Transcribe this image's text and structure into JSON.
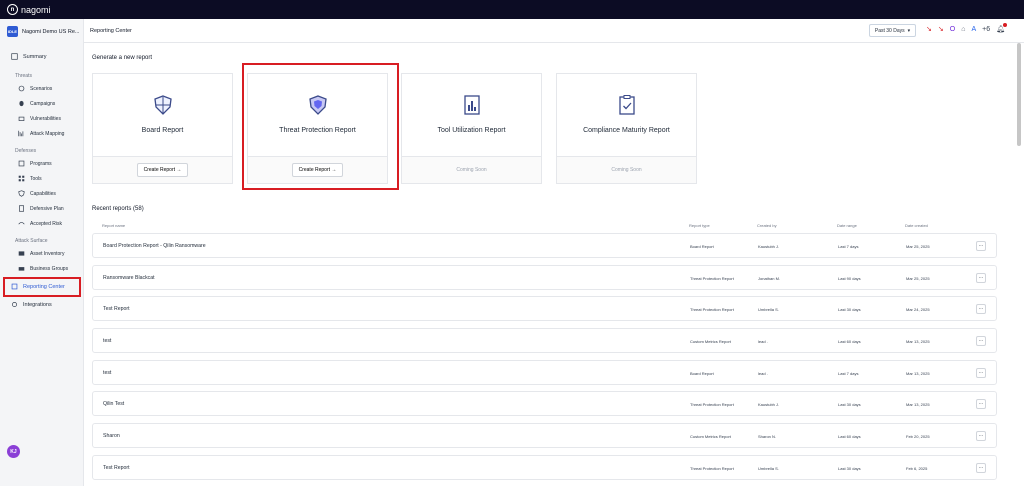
{
  "app": {
    "logo_text": "nagomi",
    "logo_mark": "n"
  },
  "org": {
    "badge": "IDLE",
    "name": "Nagomi Demo US Re..."
  },
  "header": {
    "title": "Reporting Center",
    "range": "Past 30 Days"
  },
  "sidebar": {
    "summary": "Summary",
    "threats_label": "Threats",
    "scenarios": "Scenarios",
    "campaigns": "Campaigns",
    "vulnerabilities": "Vulnerabilities",
    "attack_mapping": "Attack Mapping",
    "defenses_label": "Defenses",
    "programs": "Programs",
    "tools": "Tools",
    "capabilities": "Capabilities",
    "defensive_plan": "Defensive Plan",
    "accepted_risk": "Accepted Risk",
    "attack_surface_label": "Attack Surface",
    "asset_inventory": "Asset Inventory",
    "business_groups": "Business Groups",
    "reporting_center": "Reporting Center",
    "integrations": "Integrations",
    "avatar": "KJ"
  },
  "generate": {
    "title": "Generate a new report",
    "cards": [
      {
        "name": "Board Report",
        "action": "Create Report →"
      },
      {
        "name": "Threat Protection Report",
        "action": "Create Report →"
      },
      {
        "name": "Tool Utilization Report",
        "action": "Coming Soon"
      },
      {
        "name": "Compliance Maturity Report",
        "action": "Coming Soon"
      }
    ]
  },
  "recent": {
    "title": "Recent reports (58)",
    "columns": [
      "Report name",
      "Report type",
      "Created by",
      "Date range",
      "Date created"
    ],
    "rows": [
      {
        "name": "Board Protection Report - Qilin Ransomware",
        "type": "Board Report",
        "by": "Kaustubh J.",
        "range": "Last 7 days",
        "created": "Mar 25, 2025"
      },
      {
        "name": "Ransomware Blackcat",
        "type": "Threat Protection Report",
        "by": "Jonathan M.",
        "range": "Last 90 days",
        "created": "Mar 25, 2025"
      },
      {
        "name": "Test Report",
        "type": "Threat Protection Report",
        "by": "Umbrella S.",
        "range": "Last 30 days",
        "created": "Mar 24, 2025"
      },
      {
        "name": "test",
        "type": "Custom Metrics Report",
        "by": "lead .",
        "range": "Last 60 days",
        "created": "Mar 13, 2025"
      },
      {
        "name": "test",
        "type": "Board Report",
        "by": "lead .",
        "range": "Last 7 days",
        "created": "Mar 13, 2025"
      },
      {
        "name": "Qilin Test",
        "type": "Threat Protection Report",
        "by": "Kaustubh J.",
        "range": "Last 30 days",
        "created": "Mar 13, 2025"
      },
      {
        "name": "Sharon",
        "type": "Custom Metrics Report",
        "by": "Sharon N.",
        "range": "Last 60 days",
        "created": "Feb 20, 2025"
      },
      {
        "name": "Test Report",
        "type": "Threat Protection Report",
        "by": "Umbrella S.",
        "range": "Last 30 days",
        "created": "Feb 6, 2025"
      }
    ],
    "more_label": "..."
  }
}
